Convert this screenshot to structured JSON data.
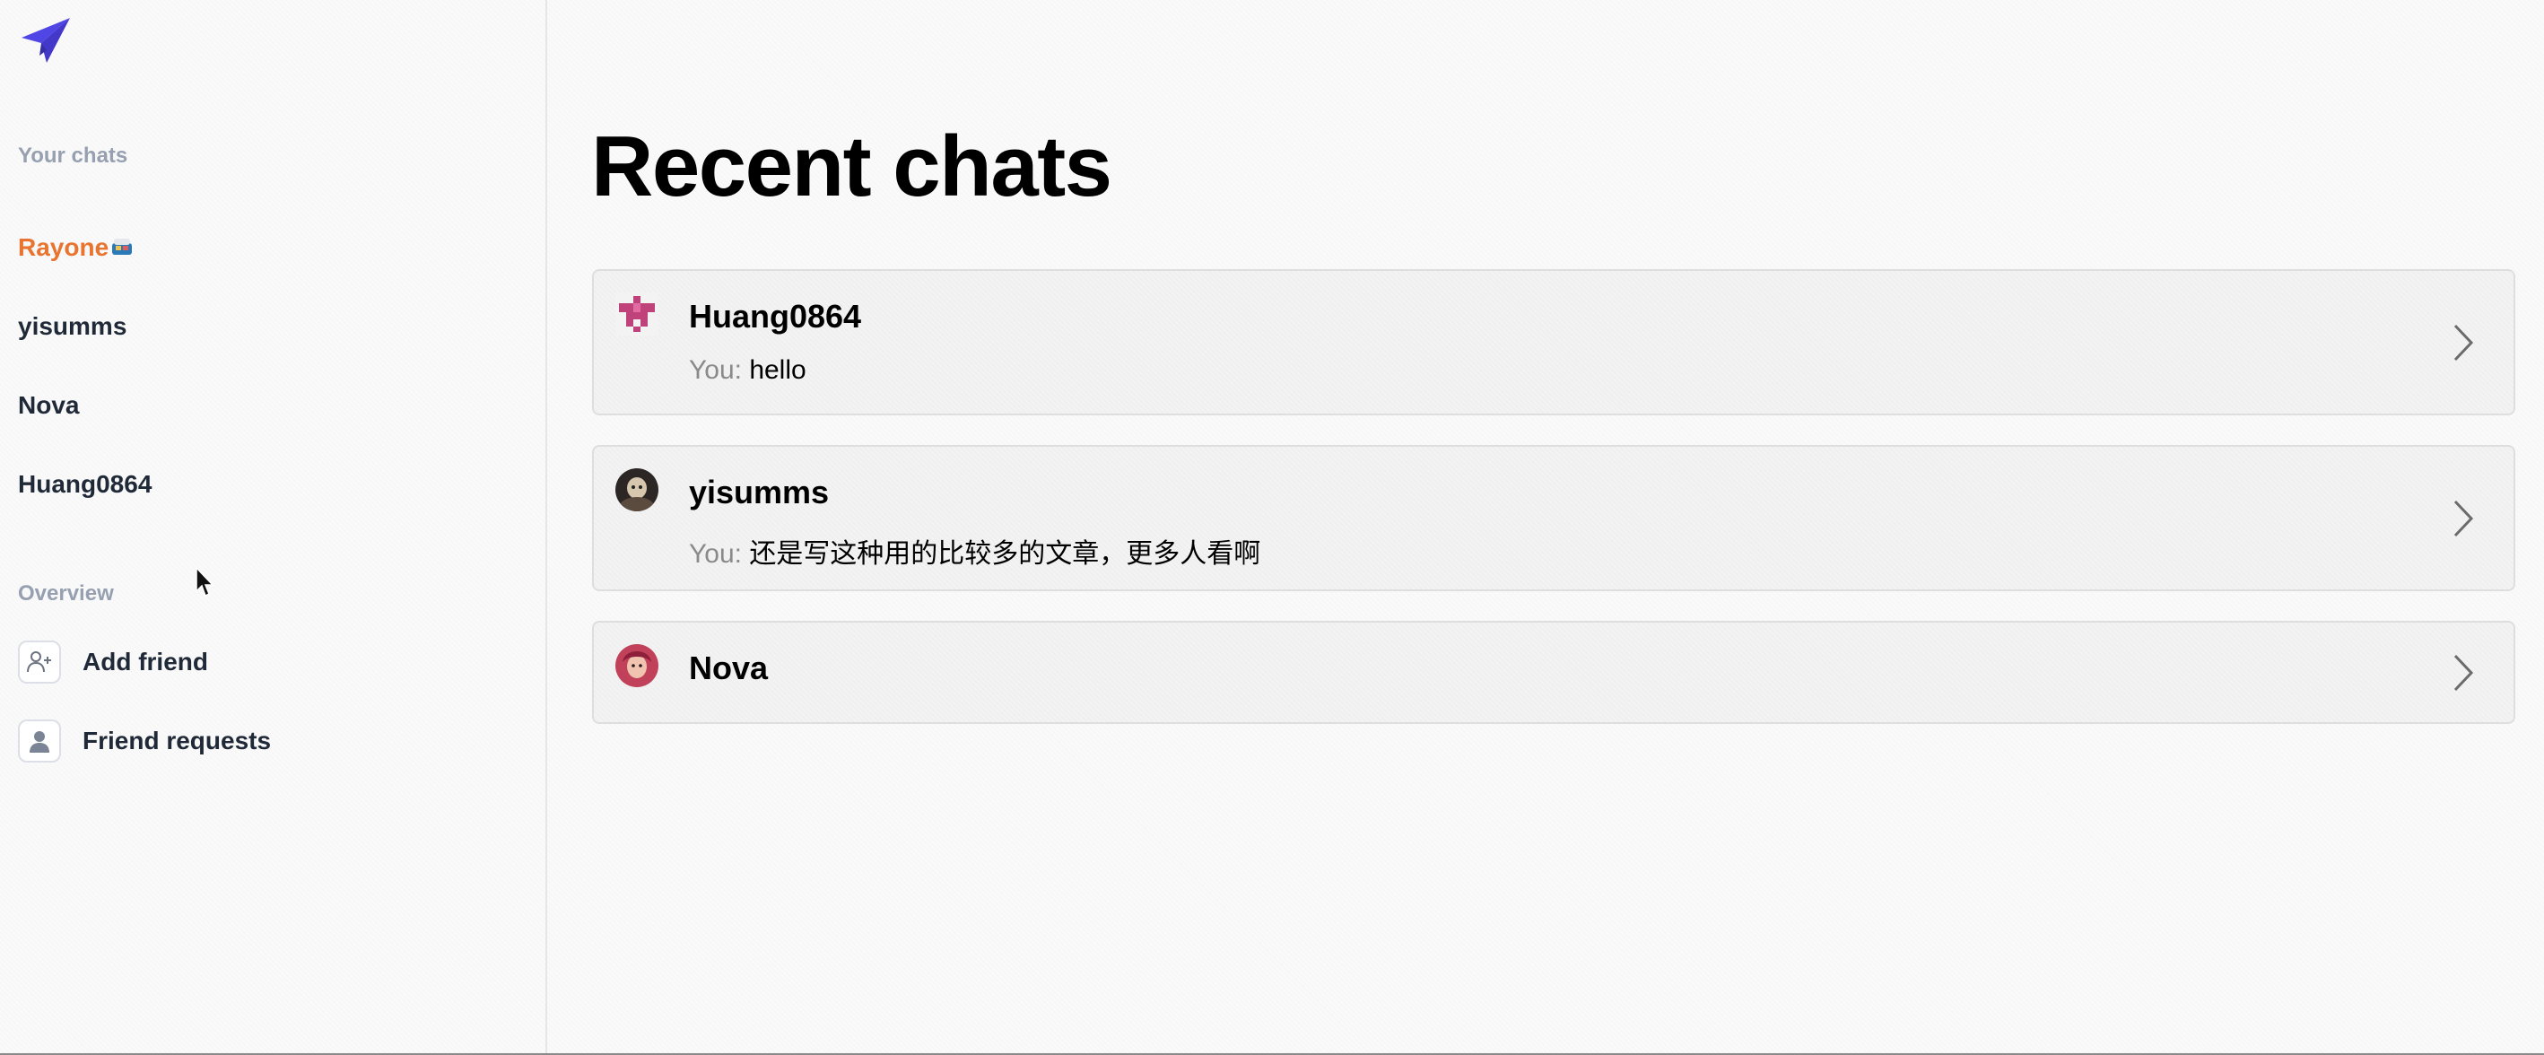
{
  "sidebar": {
    "your_chats_label": "Your chats",
    "chats": [
      {
        "name": "Rayone",
        "active": true,
        "emoji": "bento-box"
      },
      {
        "name": "yisumms"
      },
      {
        "name": "Nova"
      },
      {
        "name": "Huang0864"
      }
    ],
    "overview_label": "Overview",
    "overview_items": [
      {
        "label": "Add friend",
        "icon": "user-plus-icon"
      },
      {
        "label": "Friend requests",
        "icon": "user-icon"
      }
    ]
  },
  "main": {
    "title": "Recent chats",
    "chats": [
      {
        "name": "Huang0864",
        "you_prefix": "You:",
        "message": "hello",
        "avatar": "pixel-identicon-avatar"
      },
      {
        "name": "yisumms",
        "you_prefix": "You:",
        "message": "还是写这种用的比较多的文章，更多人看啊",
        "avatar": "photo-avatar"
      },
      {
        "name": "Nova",
        "avatar": "photo-avatar"
      }
    ]
  },
  "colors": {
    "brand": "#4f46e5",
    "active_chat": "#e8742f",
    "section_label": "#97a0b0",
    "muted_text": "#8a8a8a"
  }
}
